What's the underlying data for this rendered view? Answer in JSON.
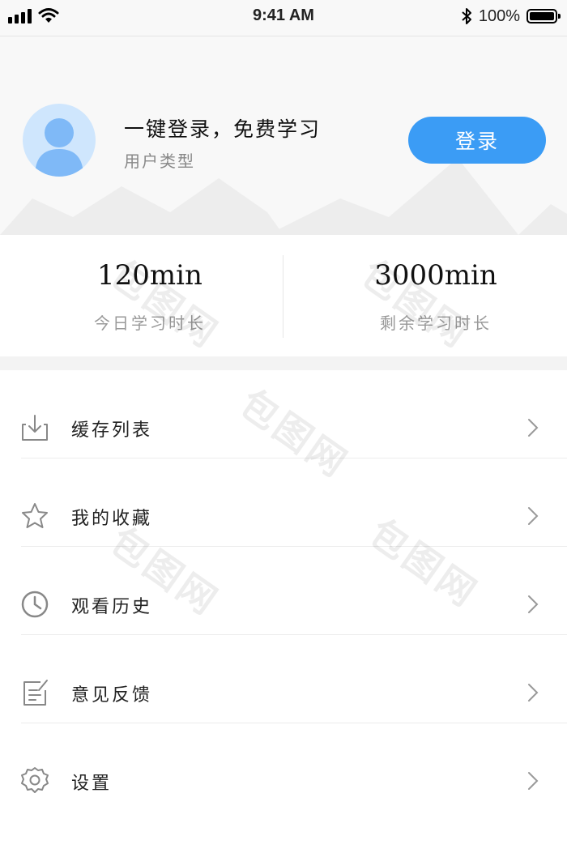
{
  "status_bar": {
    "time": "9:41 AM",
    "battery": "100%"
  },
  "profile": {
    "title": "一键登录，免费学习",
    "user_type": "用户类型",
    "login_label": "登录"
  },
  "stats": [
    {
      "value": "120min",
      "label": "今日学习时长"
    },
    {
      "value": "3000min",
      "label": "剩余学习时长"
    }
  ],
  "menu": [
    {
      "label": "缓存列表",
      "icon": "download-icon"
    },
    {
      "label": "我的收藏",
      "icon": "star-icon"
    },
    {
      "label": "观看历史",
      "icon": "clock-icon"
    },
    {
      "label": "意见反馈",
      "icon": "feedback-icon"
    },
    {
      "label": "设置",
      "icon": "gear-icon"
    }
  ],
  "watermark": "包图网",
  "colors": {
    "accent": "#3b9cf5",
    "avatar_bg": "#cfe6fd",
    "header_bg": "#f8f8f8"
  }
}
